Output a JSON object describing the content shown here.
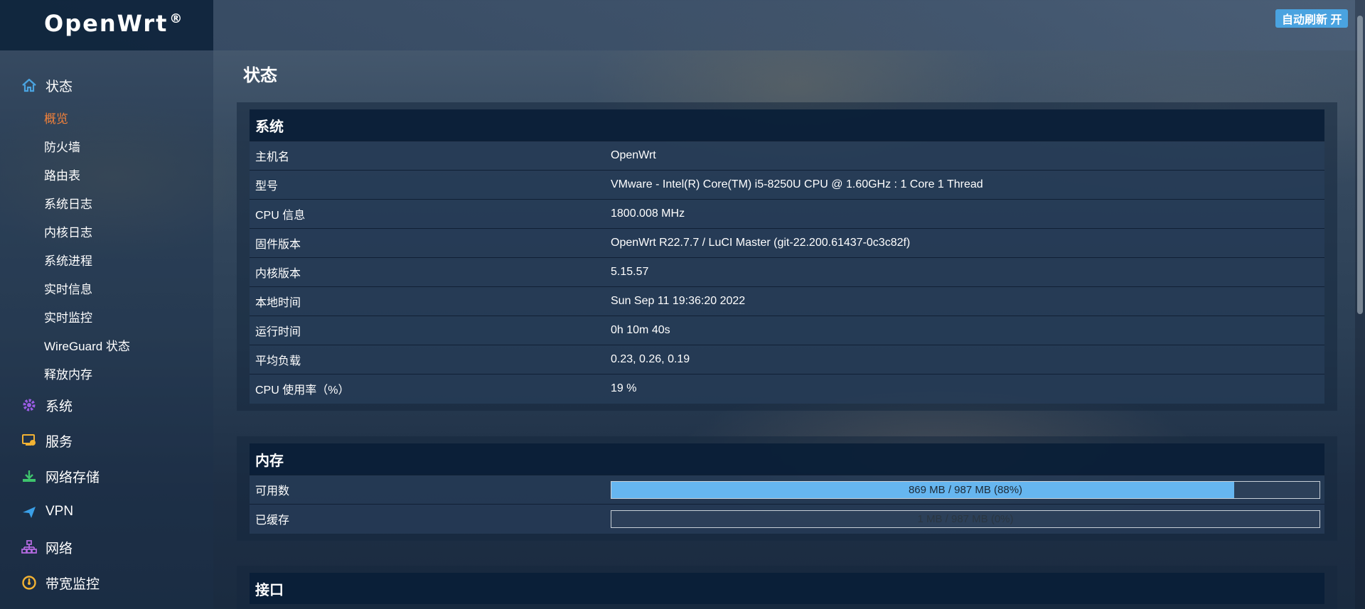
{
  "app": {
    "brand": "OpenWrt",
    "brand_mark": "®",
    "auto_refresh_label": "自动刷新 开",
    "accent_color": "#4aa3e0",
    "active_color": "#f0803a"
  },
  "sidebar": {
    "status_group": "状态",
    "status_items": [
      "概览",
      "防火墙",
      "路由表",
      "系统日志",
      "内核日志",
      "系统进程",
      "实时信息",
      "实时监控",
      "WireGuard 状态",
      "释放内存"
    ],
    "active_item": "概览",
    "groups": [
      {
        "label": "系统",
        "icon": "gear-icon"
      },
      {
        "label": "服务",
        "icon": "services-icon"
      },
      {
        "label": "网络存储",
        "icon": "storage-icon"
      },
      {
        "label": "VPN",
        "icon": "vpn-icon"
      },
      {
        "label": "网络",
        "icon": "network-icon"
      },
      {
        "label": "带宽监控",
        "icon": "gauge-icon"
      }
    ]
  },
  "page": {
    "title": "状态"
  },
  "system": {
    "heading": "系统",
    "rows": [
      {
        "key": "主机名",
        "value": "OpenWrt"
      },
      {
        "key": "型号",
        "value": "VMware - Intel(R) Core(TM) i5-8250U CPU @ 1.60GHz : 1 Core 1 Thread"
      },
      {
        "key": "CPU 信息",
        "value": "1800.008 MHz"
      },
      {
        "key": "固件版本",
        "value": "OpenWrt R22.7.7 / LuCI Master (git-22.200.61437-0c3c82f)"
      },
      {
        "key": "内核版本",
        "value": "5.15.57"
      },
      {
        "key": "本地时间",
        "value": "Sun Sep 11 19:36:20 2022"
      },
      {
        "key": "运行时间",
        "value": "0h 10m 40s"
      },
      {
        "key": "平均负载",
        "value": "0.23, 0.26, 0.19"
      },
      {
        "key": "CPU 使用率（%）",
        "value": "19 %"
      }
    ]
  },
  "memory": {
    "heading": "内存",
    "rows": [
      {
        "key": "可用数",
        "text": "869 MB / 987 MB (88%)",
        "fraction": 0.88
      },
      {
        "key": "已缓存",
        "text": "1 MB / 987 MB (0%)",
        "fraction": 0.0
      }
    ]
  },
  "interfaces": {
    "heading": "接口"
  }
}
